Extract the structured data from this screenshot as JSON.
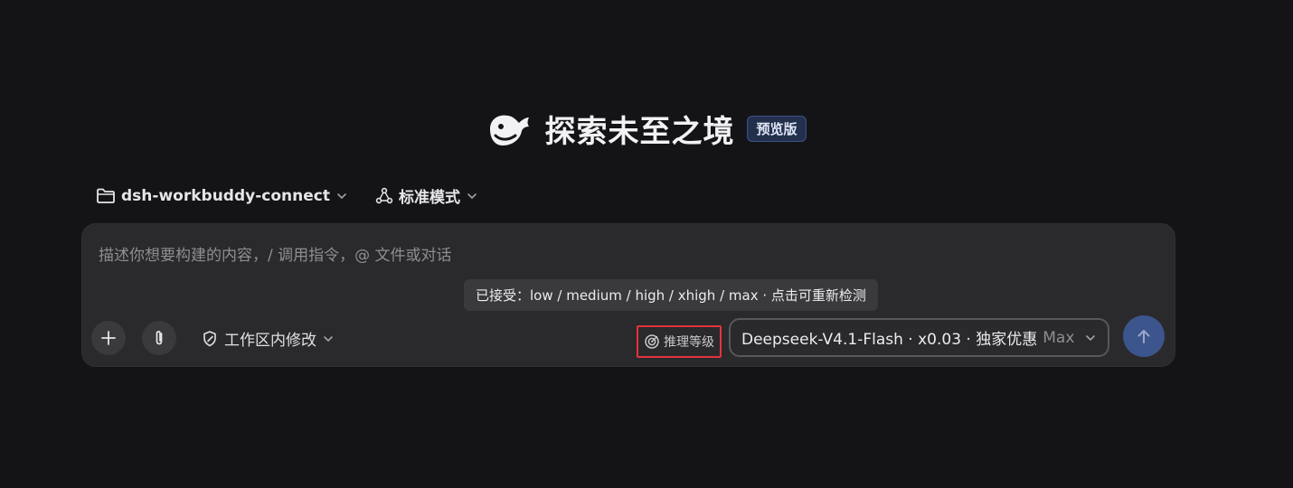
{
  "hero": {
    "title": "探索未至之境",
    "badge": "预览版",
    "logo_icon": "whale-logo-icon"
  },
  "selectors": {
    "workspace": {
      "label": "dsh-workbuddy-connect",
      "icon": "folder-icon"
    },
    "mode": {
      "label": "标准模式",
      "icon": "share-nodes-icon"
    }
  },
  "composer": {
    "placeholder": "描述你想要构建的内容，/ 调用指令，@ 文件或对话",
    "value": "",
    "tooltip": "已接受：low / medium / high / xhigh / max · 点击可重新检测",
    "scope_label": "工作区内修改",
    "reasoning_label": "推理等级",
    "model_name": "Deepseek-V4.1-Flash · x0.03 · 独家优惠",
    "model_level": "Max"
  },
  "colors": {
    "background": "#141416",
    "panel": "#2a2a2d",
    "highlight_border": "#e4333a",
    "send_button": "#3d558d",
    "badge_bg": "#23304d"
  }
}
